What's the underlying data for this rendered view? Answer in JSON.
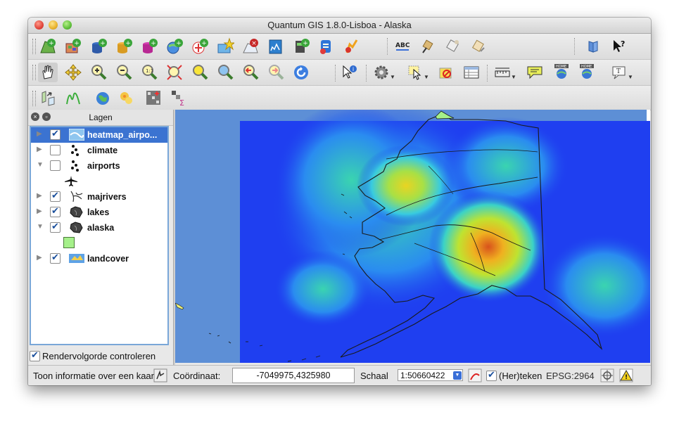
{
  "window": {
    "title": "Quantum GIS 1.8.0-Lisboa - Alaska"
  },
  "toolbar_row1": [
    "new-vector-layer-icon",
    "add-raster-layer-icon",
    "add-postgis-layer-icon",
    "add-spatialite-layer-icon",
    "add-mssql-layer-icon",
    "add-wms-layer-icon",
    "add-wfs-layer-icon",
    "add-wcs-layer-icon",
    "remove-layer-icon",
    "new-shapefile-icon",
    "add-delimited-text-icon",
    "add-grass-layer-icon",
    "add-oracle-layer-icon",
    "label-tool-icon",
    "pin-labels-icon",
    "show-hide-labels-icon",
    "move-label-icon",
    "whats-this-icon"
  ],
  "toolbar_row2": [
    "pan-icon",
    "pan-to-selection-icon",
    "zoom-in-icon",
    "zoom-out-icon",
    "zoom-actual-icon",
    "zoom-full-icon",
    "zoom-to-selection-icon",
    "zoom-to-layer-icon",
    "zoom-last-icon",
    "zoom-next-icon",
    "refresh-icon",
    "identify-icon",
    "settings-icon",
    "select-icon",
    "deselect-icon",
    "attribute-table-icon",
    "measure-icon",
    "map-tips-icon",
    "new-bookmark-icon",
    "show-bookmarks-icon",
    "text-annotation-icon"
  ],
  "toolbar_row3": [
    "georeferencer-icon",
    "histogram-icon",
    "globe-icon",
    "heatmap-icon",
    "raster-calc-icon",
    "zonal-stats-icon"
  ],
  "layers_panel": {
    "title": "Lagen",
    "layers": [
      {
        "name": "heatmap_airpo...",
        "checked": true,
        "expanded": false,
        "selected": true,
        "icon": "raster-layer-icon"
      },
      {
        "name": "climate",
        "checked": false,
        "expanded": false,
        "selected": false,
        "icon": "point-layer-icon"
      },
      {
        "name": "airports",
        "checked": false,
        "expanded": true,
        "selected": false,
        "icon": "point-layer-icon"
      },
      {
        "name": "majrivers",
        "checked": true,
        "expanded": false,
        "selected": false,
        "icon": "line-layer-icon"
      },
      {
        "name": "lakes",
        "checked": true,
        "expanded": false,
        "selected": false,
        "icon": "polygon-layer-icon"
      },
      {
        "name": "alaska",
        "checked": true,
        "expanded": true,
        "selected": false,
        "icon": "polygon-layer-icon"
      },
      {
        "name": "landcover",
        "checked": true,
        "expanded": false,
        "selected": false,
        "icon": "raster-layer-icon"
      }
    ],
    "render_order_label": "Rendervolgorde controleren",
    "render_order_checked": true
  },
  "statusbar": {
    "info_text": "Toon informatie over een kaar",
    "coord_label": "Coördinaat:",
    "coord_value": "-7049975,4325980",
    "scale_label": "Schaal",
    "scale_value": "1:50660422",
    "render_label": "(Her)teken",
    "render_checked": true,
    "crs": "EPSG:2964"
  },
  "colors": {
    "selection": "#3b73d1",
    "map_water": "#5d8fd6",
    "heat_low": "#1e3cf0",
    "heat_high": "#d8521c",
    "alaska_fill": "#a5f08a"
  }
}
